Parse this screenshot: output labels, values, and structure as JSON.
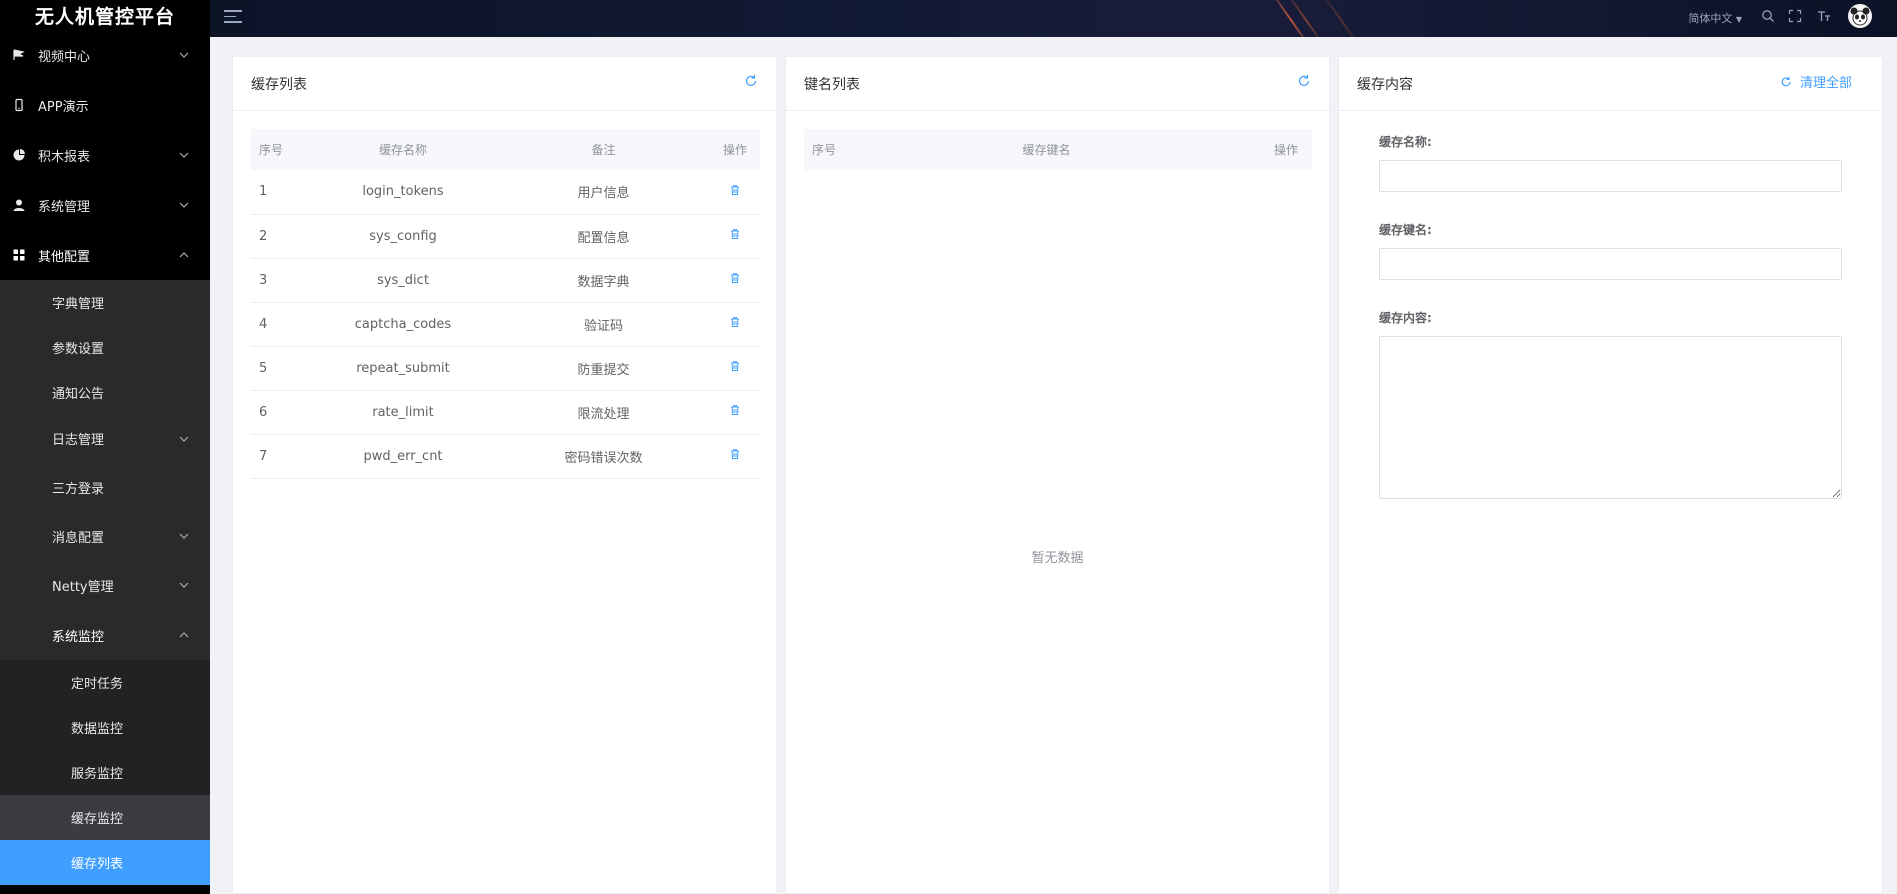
{
  "app": {
    "title": "无人机管控平台"
  },
  "header": {
    "language": "简体中文"
  },
  "sidebar": {
    "items": [
      {
        "label": "视频中心",
        "icon": "video-flag-icon",
        "hasChildren": true
      },
      {
        "label": "APP演示",
        "icon": "mobile-icon",
        "hasChildren": false
      },
      {
        "label": "积木报表",
        "icon": "pie-chart-icon",
        "hasChildren": true
      },
      {
        "label": "系统管理",
        "icon": "user-icon",
        "hasChildren": true
      },
      {
        "label": "其他配置",
        "icon": "grid-icon",
        "hasChildren": true,
        "expanded": true
      }
    ],
    "other_config_children": [
      {
        "label": "字典管理"
      },
      {
        "label": "参数设置"
      },
      {
        "label": "通知公告"
      },
      {
        "label": "日志管理",
        "hasChildren": true
      },
      {
        "label": "三方登录"
      },
      {
        "label": "消息配置",
        "hasChildren": true
      },
      {
        "label": "Netty管理",
        "hasChildren": true
      },
      {
        "label": "系统监控",
        "hasChildren": true,
        "expanded": true
      }
    ],
    "monitor_children": [
      {
        "label": "定时任务"
      },
      {
        "label": "数据监控"
      },
      {
        "label": "服务监控"
      },
      {
        "label": "缓存监控"
      },
      {
        "label": "缓存列表",
        "active": true
      }
    ]
  },
  "cache_list": {
    "title": "缓存列表",
    "columns": [
      "序号",
      "缓存名称",
      "备注",
      "操作"
    ],
    "rows": [
      {
        "no": "1",
        "name": "login_tokens",
        "remark": "用户信息"
      },
      {
        "no": "2",
        "name": "sys_config",
        "remark": "配置信息"
      },
      {
        "no": "3",
        "name": "sys_dict",
        "remark": "数据字典"
      },
      {
        "no": "4",
        "name": "captcha_codes",
        "remark": "验证码"
      },
      {
        "no": "5",
        "name": "repeat_submit",
        "remark": "防重提交"
      },
      {
        "no": "6",
        "name": "rate_limit",
        "remark": "限流处理"
      },
      {
        "no": "7",
        "name": "pwd_err_cnt",
        "remark": "密码错误次数"
      }
    ]
  },
  "key_list": {
    "title": "键名列表",
    "columns": [
      "序号",
      "缓存键名",
      "操作"
    ],
    "empty_text": "暂无数据"
  },
  "cache_content": {
    "title": "缓存内容",
    "clear_all_label": "清理全部",
    "name_label": "缓存名称:",
    "key_label": "缓存键名:",
    "content_label": "缓存内容:",
    "name_value": "",
    "key_value": "",
    "content_value": ""
  },
  "colors": {
    "accent": "#409eff",
    "sidebar_bg": "#000000"
  }
}
